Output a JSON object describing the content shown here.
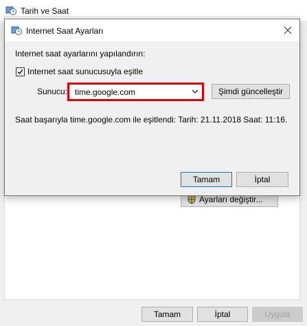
{
  "parent": {
    "title": "Tarih ve Saat",
    "change_settings_label": "Ayarları değiştir...",
    "buttons": {
      "ok": "Tamam",
      "cancel": "İptal",
      "apply": "Uygula"
    }
  },
  "dialog": {
    "title": "Internet Saat Ayarları",
    "instruction": "Internet saat ayarlarını yapılandırın:",
    "sync_checkbox_label": "Internet saat sunucusuyla eşitle",
    "sync_checked": true,
    "server_label": "Sunucu:",
    "server_value": "time.google.com",
    "update_now_label": "Şimdi güncelleştir",
    "status_text": "Saat başarıyla time.google.com ile eşitlendi: Tarih: 21.11.2018 Saat: 11:16.",
    "buttons": {
      "ok": "Tamam",
      "cancel": "İptal"
    }
  },
  "colors": {
    "highlight_border": "#e00000",
    "accent": "#0078d7"
  },
  "icons": {
    "app": "clock-globe-icon",
    "close": "close-icon",
    "dropdown": "chevron-down-icon",
    "shield": "uac-shield-icon"
  }
}
